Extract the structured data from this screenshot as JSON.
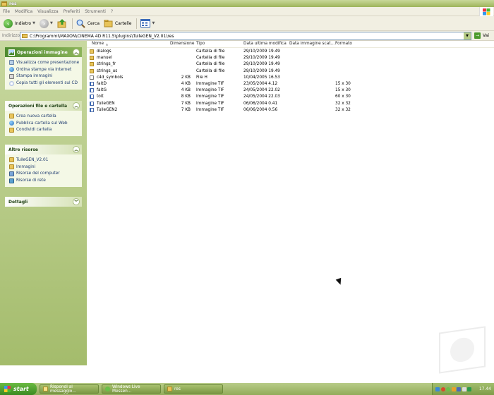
{
  "window": {
    "title": "res"
  },
  "menu": [
    "File",
    "Modifica",
    "Visualizza",
    "Preferiti",
    "Strumenti",
    "?"
  ],
  "toolbar": {
    "back_label": "Indietro",
    "search_label": "Cerca",
    "folders_label": "Cartelle"
  },
  "address": {
    "label": "Indirizzo",
    "path": "C:\\Programmi\\MAXON\\CINEMA 4D R11.5\\plugins\\TuileGEN_V2.01\\res",
    "go_label": "Vai"
  },
  "panels": {
    "image_tasks": {
      "title": "Operazioni immagine",
      "items": [
        {
          "label": "Visualizza come presentazione",
          "icon": "slideshow-icon"
        },
        {
          "label": "Ordina stampe via Internet",
          "icon": "globe-icon"
        },
        {
          "label": "Stampa immagini",
          "icon": "printer-icon"
        },
        {
          "label": "Copia tutti gli elementi sul CD",
          "icon": "cd-icon"
        }
      ]
    },
    "file_tasks": {
      "title": "Operazioni file e cartella",
      "items": [
        {
          "label": "Crea nuova cartella",
          "icon": "new-folder-icon"
        },
        {
          "label": "Pubblica cartella sul Web",
          "icon": "globe-icon"
        },
        {
          "label": "Condividi cartella",
          "icon": "share-folder-icon"
        }
      ]
    },
    "other_places": {
      "title": "Altre risorse",
      "items": [
        {
          "label": "TuileGEN_V2.01",
          "icon": "folder-icon"
        },
        {
          "label": "Immagini",
          "icon": "pictures-folder-icon"
        },
        {
          "label": "Risorse del computer",
          "icon": "computer-icon"
        },
        {
          "label": "Risorse di rete",
          "icon": "network-icon"
        }
      ]
    },
    "details": {
      "title": "Dettagli"
    }
  },
  "columns": {
    "name": "Nome",
    "size": "Dimensione",
    "type": "Tipo",
    "modified": "Data ultima modifica",
    "taken": "Data immagine scat...",
    "format": "Formato"
  },
  "files": [
    {
      "name": "dialogs",
      "size": "",
      "type": "Cartella di file",
      "modified": "29/10/2009 19.49",
      "format": "",
      "kind": "folder"
    },
    {
      "name": "manuel",
      "size": "",
      "type": "Cartella di file",
      "modified": "29/10/2009 19.49",
      "format": "",
      "kind": "folder"
    },
    {
      "name": "strings_fr",
      "size": "",
      "type": "Cartella di file",
      "modified": "29/10/2009 19.49",
      "format": "",
      "kind": "folder"
    },
    {
      "name": "strings_us",
      "size": "",
      "type": "Cartella di file",
      "modified": "29/10/2009 19.49",
      "format": "",
      "kind": "folder"
    },
    {
      "name": "c4d_symbols",
      "size": "2 KB",
      "type": "File H",
      "modified": "10/04/2005 16.53",
      "format": "",
      "kind": "file"
    },
    {
      "name": "faitD",
      "size": "4 KB",
      "type": "Immagine TIF",
      "modified": "23/05/2004 4.12",
      "format": "15 x 30",
      "kind": "tif"
    },
    {
      "name": "faitG",
      "size": "4 KB",
      "type": "Immagine TIF",
      "modified": "24/05/2004 22.02",
      "format": "15 x 30",
      "kind": "tif"
    },
    {
      "name": "toit",
      "size": "8 KB",
      "type": "Immagine TIF",
      "modified": "24/05/2004 22.03",
      "format": "60 x 30",
      "kind": "tif"
    },
    {
      "name": "TuileGEN",
      "size": "7 KB",
      "type": "Immagine TIF",
      "modified": "06/06/2004 0.41",
      "format": "32 x 32",
      "kind": "tif"
    },
    {
      "name": "TuileGEN2",
      "size": "7 KB",
      "type": "Immagine TIF",
      "modified": "06/06/2004 0.56",
      "format": "32 x 32",
      "kind": "tif"
    }
  ],
  "taskbar": {
    "start_label": "start",
    "tasks": [
      {
        "label": "Rispondi al messaggio..."
      },
      {
        "label": "Windows Live Messen..."
      },
      {
        "label": "res"
      }
    ],
    "clock": "17.44"
  }
}
